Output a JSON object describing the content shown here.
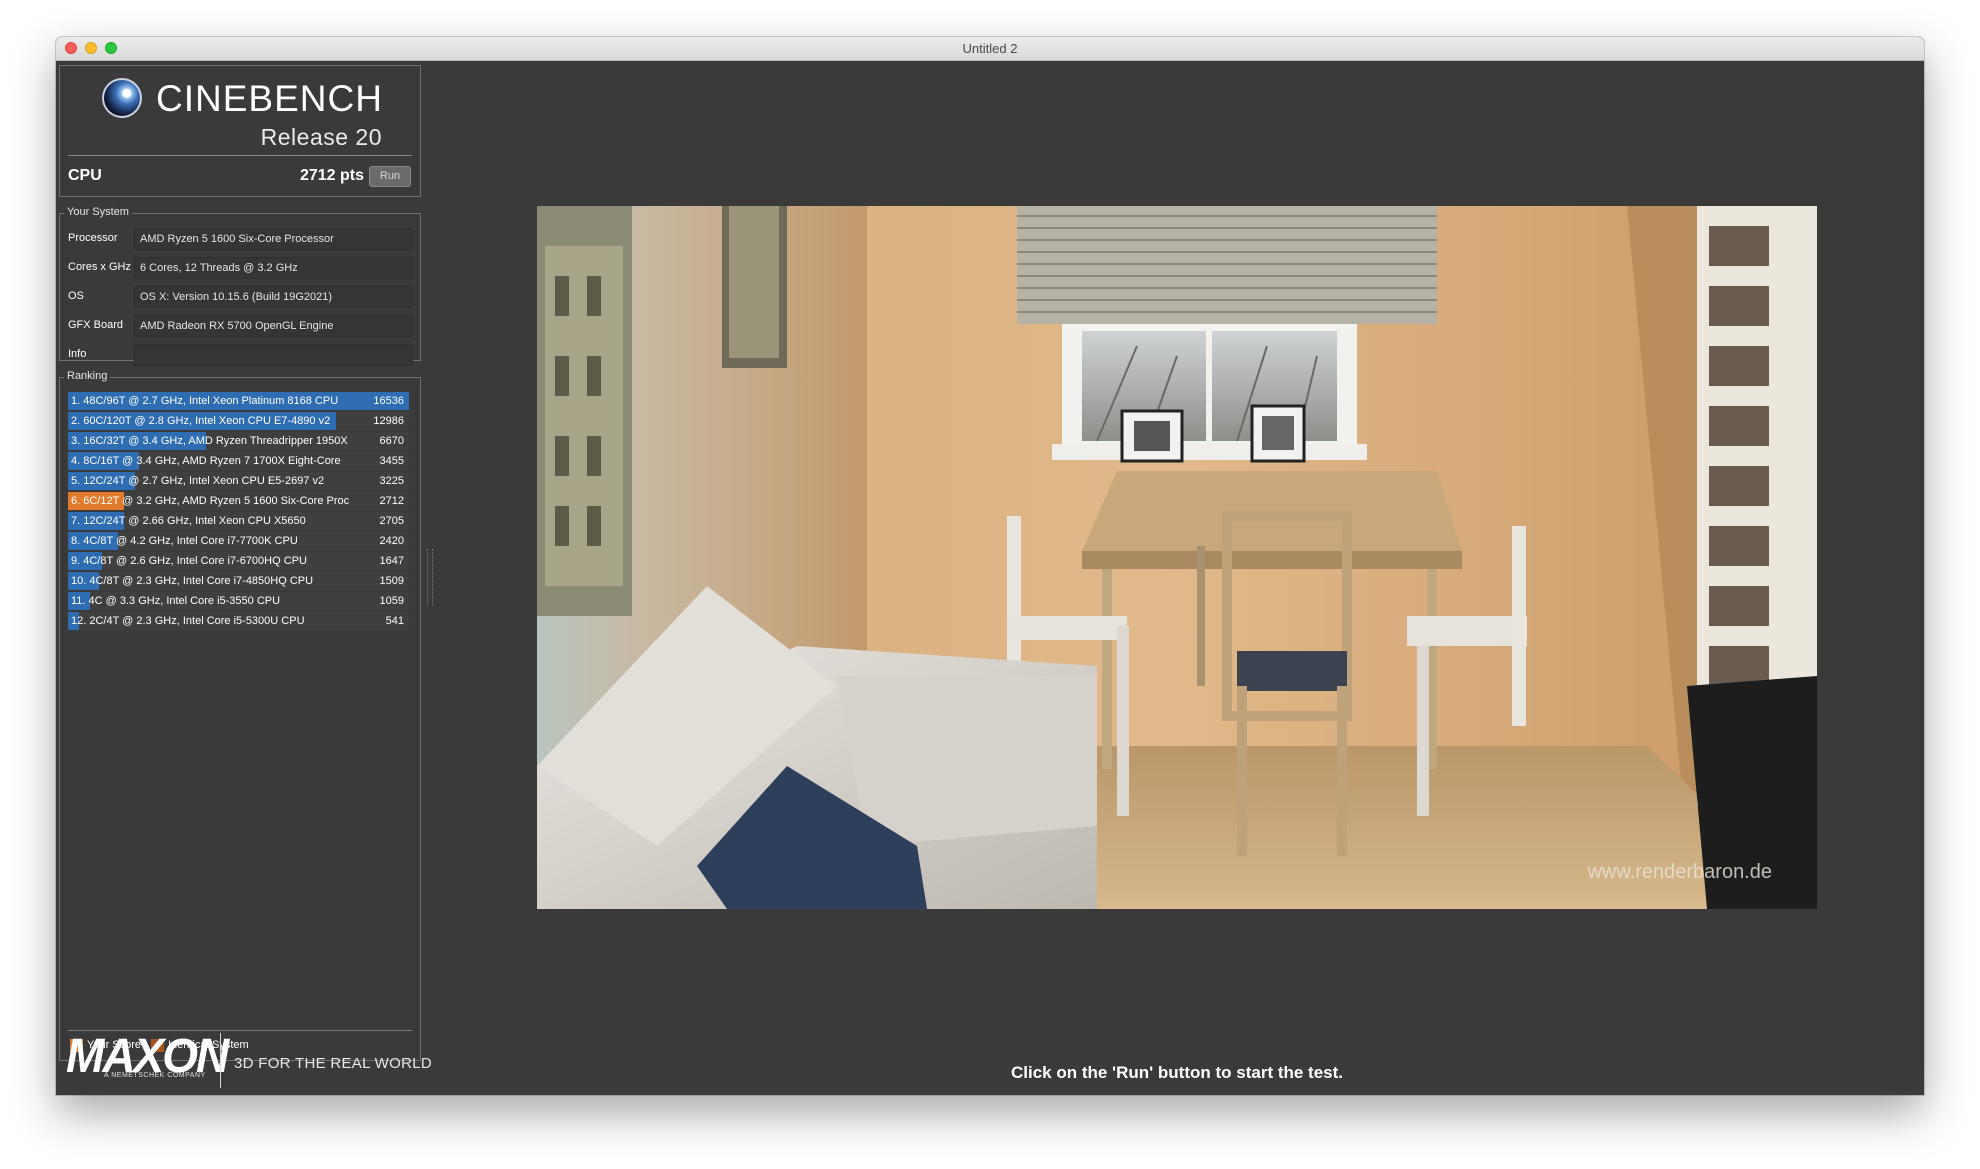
{
  "window": {
    "title": "Untitled 2"
  },
  "brand": {
    "name": "CINEBENCH",
    "release": "Release 20",
    "maker": "MAXON",
    "maker_sub": "A NEMETSCHEK COMPANY",
    "tagline": "3D FOR THE REAL WORLD"
  },
  "test": {
    "label": "CPU",
    "score": "2712 pts",
    "run_label": "Run"
  },
  "your_system": {
    "legend": "Your System",
    "rows": [
      {
        "label": "Processor",
        "value": "AMD Ryzen 5 1600 Six-Core Processor"
      },
      {
        "label": "Cores x GHz",
        "value": "6 Cores, 12 Threads @ 3.2 GHz"
      },
      {
        "label": "OS",
        "value": "OS X: Version 10.15.6 (Build 19G2021)"
      },
      {
        "label": "GFX Board",
        "value": "AMD Radeon RX 5700 OpenGL Engine"
      },
      {
        "label": "Info",
        "value": ""
      }
    ]
  },
  "ranking": {
    "legend": "Ranking",
    "max_score": 16536,
    "items": [
      {
        "text": "1. 48C/96T @ 2.7 GHz, Intel Xeon Platinum 8168 CPU",
        "score": "16536",
        "value": 16536,
        "type": "ref"
      },
      {
        "text": "2. 60C/120T @ 2.8 GHz, Intel Xeon CPU E7-4890 v2",
        "score": "12986",
        "value": 12986,
        "type": "ref"
      },
      {
        "text": "3. 16C/32T @ 3.4 GHz, AMD Ryzen Threadripper 1950X",
        "score": "6670",
        "value": 6670,
        "type": "ref"
      },
      {
        "text": "4. 8C/16T @ 3.4 GHz, AMD Ryzen 7 1700X Eight-Core",
        "score": "3455",
        "value": 3455,
        "type": "ref"
      },
      {
        "text": "5. 12C/24T @ 2.7 GHz, Intel Xeon CPU E5-2697 v2",
        "score": "3225",
        "value": 3225,
        "type": "ref"
      },
      {
        "text": "6. 6C/12T @ 3.2 GHz, AMD Ryzen 5 1600 Six-Core Proc",
        "score": "2712",
        "value": 2712,
        "type": "yours"
      },
      {
        "text": "7. 12C/24T @ 2.66 GHz, Intel Xeon CPU X5650",
        "score": "2705",
        "value": 2705,
        "type": "ref"
      },
      {
        "text": "8. 4C/8T @ 4.2 GHz, Intel Core i7-7700K CPU",
        "score": "2420",
        "value": 2420,
        "type": "ref"
      },
      {
        "text": "9. 4C/8T @ 2.6 GHz, Intel Core i7-6700HQ CPU",
        "score": "1647",
        "value": 1647,
        "type": "ref"
      },
      {
        "text": "10. 4C/8T @ 2.3 GHz, Intel Core i7-4850HQ CPU",
        "score": "1509",
        "value": 1509,
        "type": "ref"
      },
      {
        "text": "11. 4C @ 3.3 GHz, Intel Core i5-3550 CPU",
        "score": "1059",
        "value": 1059,
        "type": "ref"
      },
      {
        "text": "12. 2C/4T @ 2.3 GHz, Intel Core i5-5300U CPU",
        "score": "541",
        "value": 541,
        "type": "ref"
      }
    ],
    "legend_items": [
      {
        "label": "Your Score",
        "color": "#e07a2c"
      },
      {
        "label": "Identical System",
        "color": "#a8541d"
      }
    ]
  },
  "colors": {
    "reference_bar": "#2f6db3",
    "your_bar": "#e07a2c"
  },
  "render": {
    "watermark": "www.renderbaron.de"
  },
  "status": "Click on the 'Run' button to start the test."
}
